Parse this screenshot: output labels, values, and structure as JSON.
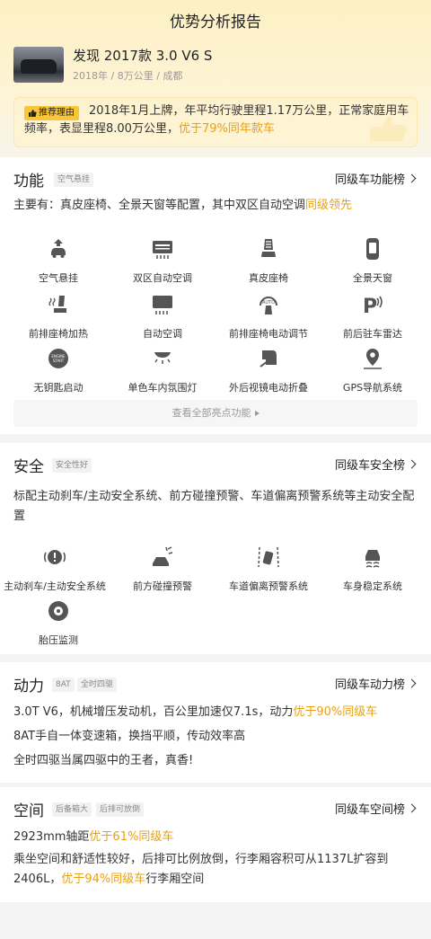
{
  "header": {
    "title": "优势分析报告"
  },
  "car": {
    "name": "发现 2017款 3.0 V6 S",
    "meta": "2018年 / 8万公里 / 成都"
  },
  "recommend": {
    "badge": "推荐理由",
    "text_main": "2018年1月上牌，年平均行驶里程1.17万公里，正常家庭用车频率，表显里程8.00万公里，",
    "text_hl": "优于79%同年款车"
  },
  "function": {
    "title": "功能",
    "tag": "空气悬挂",
    "rank": "同级车功能榜",
    "summary_main": "主要有：真皮座椅、全景天窗等配置，其中双区自动空调",
    "summary_hl": "同级领先",
    "items": [
      {
        "label": "空气悬挂",
        "icon": "air-suspension-icon"
      },
      {
        "label": "双区自动空调",
        "icon": "dual-zone-ac-icon"
      },
      {
        "label": "真皮座椅",
        "icon": "leather-seat-icon"
      },
      {
        "label": "全景天窗",
        "icon": "panoramic-sunroof-icon"
      },
      {
        "label": "前排座椅加热",
        "icon": "seat-heating-icon"
      },
      {
        "label": "自动空调",
        "icon": "auto-ac-icon"
      },
      {
        "label": "前排座椅电动调节",
        "icon": "power-seat-icon"
      },
      {
        "label": "前后驻车雷达",
        "icon": "parking-radar-icon"
      },
      {
        "label": "无钥匙启动",
        "icon": "keyless-start-icon"
      },
      {
        "label": "单色车内氛围灯",
        "icon": "ambient-light-icon"
      },
      {
        "label": "外后视镜电动折叠",
        "icon": "mirror-fold-icon"
      },
      {
        "label": "GPS导航系统",
        "icon": "gps-icon"
      }
    ],
    "more": "查看全部亮点功能"
  },
  "safety": {
    "title": "安全",
    "tag": "安全性好",
    "rank": "同级车安全榜",
    "summary": "标配主动刹车/主动安全系统、前方碰撞预警、车道偏离预警系统等主动安全配置",
    "items": [
      {
        "label": "主动刹车/主动安全系统",
        "icon": "active-brake-icon"
      },
      {
        "label": "前方碰撞预警",
        "icon": "collision-warning-icon"
      },
      {
        "label": "车道偏离预警系统",
        "icon": "lane-departure-icon"
      },
      {
        "label": "车身稳定系统",
        "icon": "stability-control-icon"
      },
      {
        "label": "胎压监测",
        "icon": "tire-pressure-icon"
      }
    ]
  },
  "power": {
    "title": "动力",
    "tags": [
      "8AT",
      "全时四驱"
    ],
    "rank": "同级车动力榜",
    "line1_main": "3.0T V6，机械增压发动机，百公里加速仅7.1s，动力",
    "line1_hl": "优于90%同级车",
    "line2": "8AT手自一体变速箱，换挡平顺，传动效率高",
    "line3": "全时四驱当属四驱中的王者，真香!"
  },
  "space": {
    "title": "空间",
    "tags": [
      "后备箱大",
      "后排可放倒"
    ],
    "rank": "同级车空间榜",
    "line1_main": "2923mm轴距",
    "line1_hl": "优于61%同级车",
    "para_main": "乘坐空间和舒适性较好，后排可比例放倒，行李厢容积可从1137L扩容到2406L，",
    "para_hl": "优于94%同级车",
    "para_tail": "行李厢空间"
  },
  "colors": {
    "accent": "#e9a113",
    "badge": "#f8c638",
    "hero": "#fdf0c3"
  }
}
